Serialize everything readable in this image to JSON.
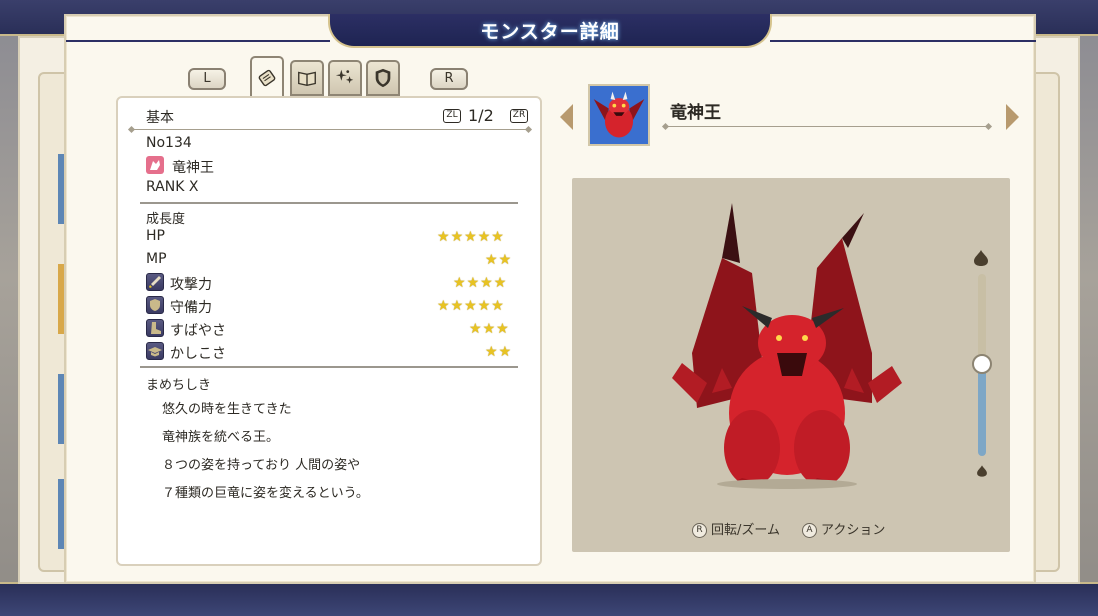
{
  "window": {
    "title": "モンスター詳細"
  },
  "nav": {
    "left_button": "L",
    "right_button": "R",
    "tabs": [
      {
        "name": "basic-info",
        "icon": "scroll-icon",
        "active": true
      },
      {
        "name": "skills",
        "icon": "book-icon",
        "active": false
      },
      {
        "name": "traits",
        "icon": "sparkle-icon",
        "active": false
      },
      {
        "name": "resistances",
        "icon": "shield-icon",
        "active": false
      }
    ]
  },
  "info": {
    "section_title": "基本",
    "page_prev": "ZL",
    "page_next": "ZR",
    "page_indicator": "1/2",
    "number": "No134",
    "family_icon": "dragon-family-icon",
    "name": "竜神王",
    "rank": "RANK  X"
  },
  "growth": {
    "title": "成長度",
    "stats": [
      {
        "label": "HP",
        "stars": 5,
        "icon": ""
      },
      {
        "label": "MP",
        "stars": 2,
        "icon": ""
      },
      {
        "label": "攻撃力",
        "stars": 4,
        "icon": "sword-icon"
      },
      {
        "label": "守備力",
        "stars": 5,
        "icon": "shield-icon"
      },
      {
        "label": "すばやさ",
        "stars": 3,
        "icon": "boot-icon"
      },
      {
        "label": "かしこさ",
        "stars": 2,
        "icon": "graduation-cap-icon"
      }
    ]
  },
  "trivia": {
    "title": "まめちしき",
    "lines": [
      "悠久の時を生きてきた",
      "竜神族を統べる王。",
      "８つの姿を持っており  人間の姿や",
      "７種類の巨竜に姿を変えるという。"
    ]
  },
  "monster": {
    "name": "竜神王"
  },
  "viewer": {
    "zoom_level": 0.5,
    "hint_rotate_button": "R",
    "hint_rotate": "回転/ズーム",
    "hint_action_button": "A",
    "hint_action": "アクション"
  },
  "colors": {
    "banner": "#2c2f64",
    "star": "#e8c323",
    "dragon_red": "#d5232c",
    "zoom_fill": "#7ea7c6"
  }
}
